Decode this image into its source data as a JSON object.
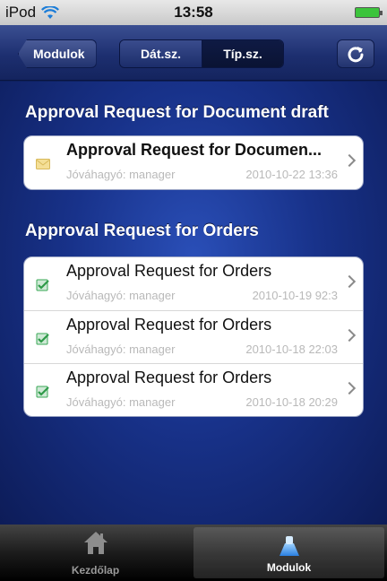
{
  "status_bar": {
    "carrier": "iPod",
    "time": "13:58"
  },
  "nav": {
    "back_label": "Modulok",
    "segments": [
      {
        "label": "Dát.sz.",
        "active": false
      },
      {
        "label": "Típ.sz.",
        "active": true
      }
    ],
    "refresh_icon": "refresh-icon"
  },
  "sections": [
    {
      "title": "Approval Request for Document draft",
      "rows": [
        {
          "title": "Approval Request for Documen...",
          "approver": "Jóváhagyó: manager",
          "date": "2010-10-22 13:36",
          "icon": "envelope-icon",
          "bold": true
        }
      ]
    },
    {
      "title": "Approval Request for Orders",
      "rows": [
        {
          "title": "Approval Request for Orders",
          "approver": "Jóváhagyó: manager",
          "date": "2010-10-19 92:3",
          "icon": "approved-document-icon",
          "bold": false
        },
        {
          "title": "Approval Request for Orders",
          "approver": "Jóváhagyó: manager",
          "date": "2010-10-18 22:03",
          "icon": "approved-document-icon",
          "bold": false
        },
        {
          "title": "Approval Request for Orders",
          "approver": "Jóváhagyó: manager",
          "date": "2010-10-18 20:29",
          "icon": "approved-document-icon",
          "bold": false
        }
      ]
    }
  ],
  "tab_bar": {
    "tabs": [
      {
        "label": "Kezdőlap",
        "icon": "home-icon",
        "active": false
      },
      {
        "label": "Modulok",
        "icon": "modules-icon",
        "active": true
      }
    ]
  },
  "colors": {
    "nav_blue": "#1d2f70",
    "content_blue": "#18328a",
    "approved_green": "#3aa856",
    "envelope_yellow": "#f2d98a"
  }
}
